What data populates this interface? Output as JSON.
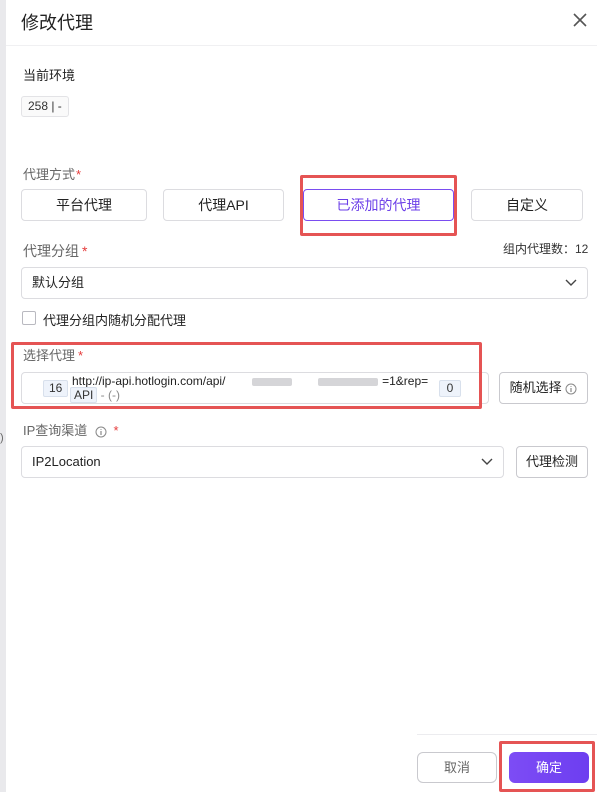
{
  "dialog": {
    "title": "修改代理",
    "close_icon": "close-icon"
  },
  "env": {
    "label": "当前环境",
    "value": "258 | -"
  },
  "proxy_mode": {
    "label": "代理方式",
    "required_mark": "*",
    "options": [
      "平台代理",
      "代理API",
      "已添加的代理",
      "自定义"
    ],
    "selected": "已添加的代理"
  },
  "proxy_group": {
    "label": "代理分组",
    "required_mark": "*",
    "count_text": "组内代理数：12",
    "value": "默认分组",
    "checkbox_label": "代理分组内随机分配代理",
    "checked": false
  },
  "select_proxy": {
    "label": "选择代理",
    "required_mark": "*",
    "id_tag": "16",
    "url_start": "http://ip-api.hotlogin.com/api/",
    "url_end": "=1&rep=",
    "api_tag": "API",
    "sub_suffix": " - (-)",
    "count_tag": "0",
    "random_button": "随机选择"
  },
  "ip_channel": {
    "label": "IP查询渠道",
    "required_mark": "*",
    "value": "IP2Location",
    "check_button": "代理检测"
  },
  "left_edge_text": ")",
  "footer": {
    "cancel": "取消",
    "confirm": "确定"
  },
  "colors": {
    "accent": "#6b3ee8",
    "highlight": "#e55454",
    "required": "#e53b3b"
  }
}
